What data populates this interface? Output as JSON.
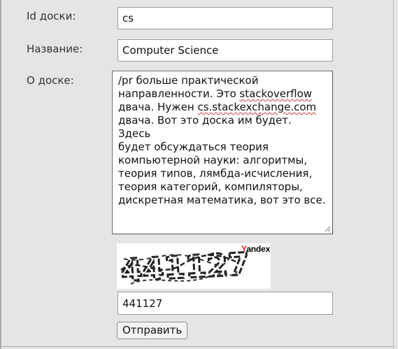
{
  "form": {
    "board_id": {
      "label": "Id доски:",
      "value": "cs"
    },
    "name": {
      "label": "Название:",
      "value": "Computer Science"
    },
    "about": {
      "label": "О доске:",
      "text_before_1": "/pr больше практической\nнаправленности. Это ",
      "spell_1": "stackoverflow",
      "text_before_2": "\nдвача. Нужен ",
      "spell_2": "cs.stackexchange.com",
      "text_after": "\nдвача. Вот это доска им будет. Здесь\nбудет обсуждаться теория\nкомпьютерной науки: алгоритмы,\nтеория типов, лямбда-исчисления,\nтеория категорий, компиляторы,\nдискретная математика, вот это все."
    },
    "captcha": {
      "brand_first": "Y",
      "brand_rest": "andex",
      "image_text": "441127",
      "input_value": "441127"
    },
    "submit_label": "Отправить"
  },
  "colors": {
    "background": "#e5e5e5",
    "spellcheck_underline": "#d23a3a",
    "yandex_red": "#e2291f"
  }
}
